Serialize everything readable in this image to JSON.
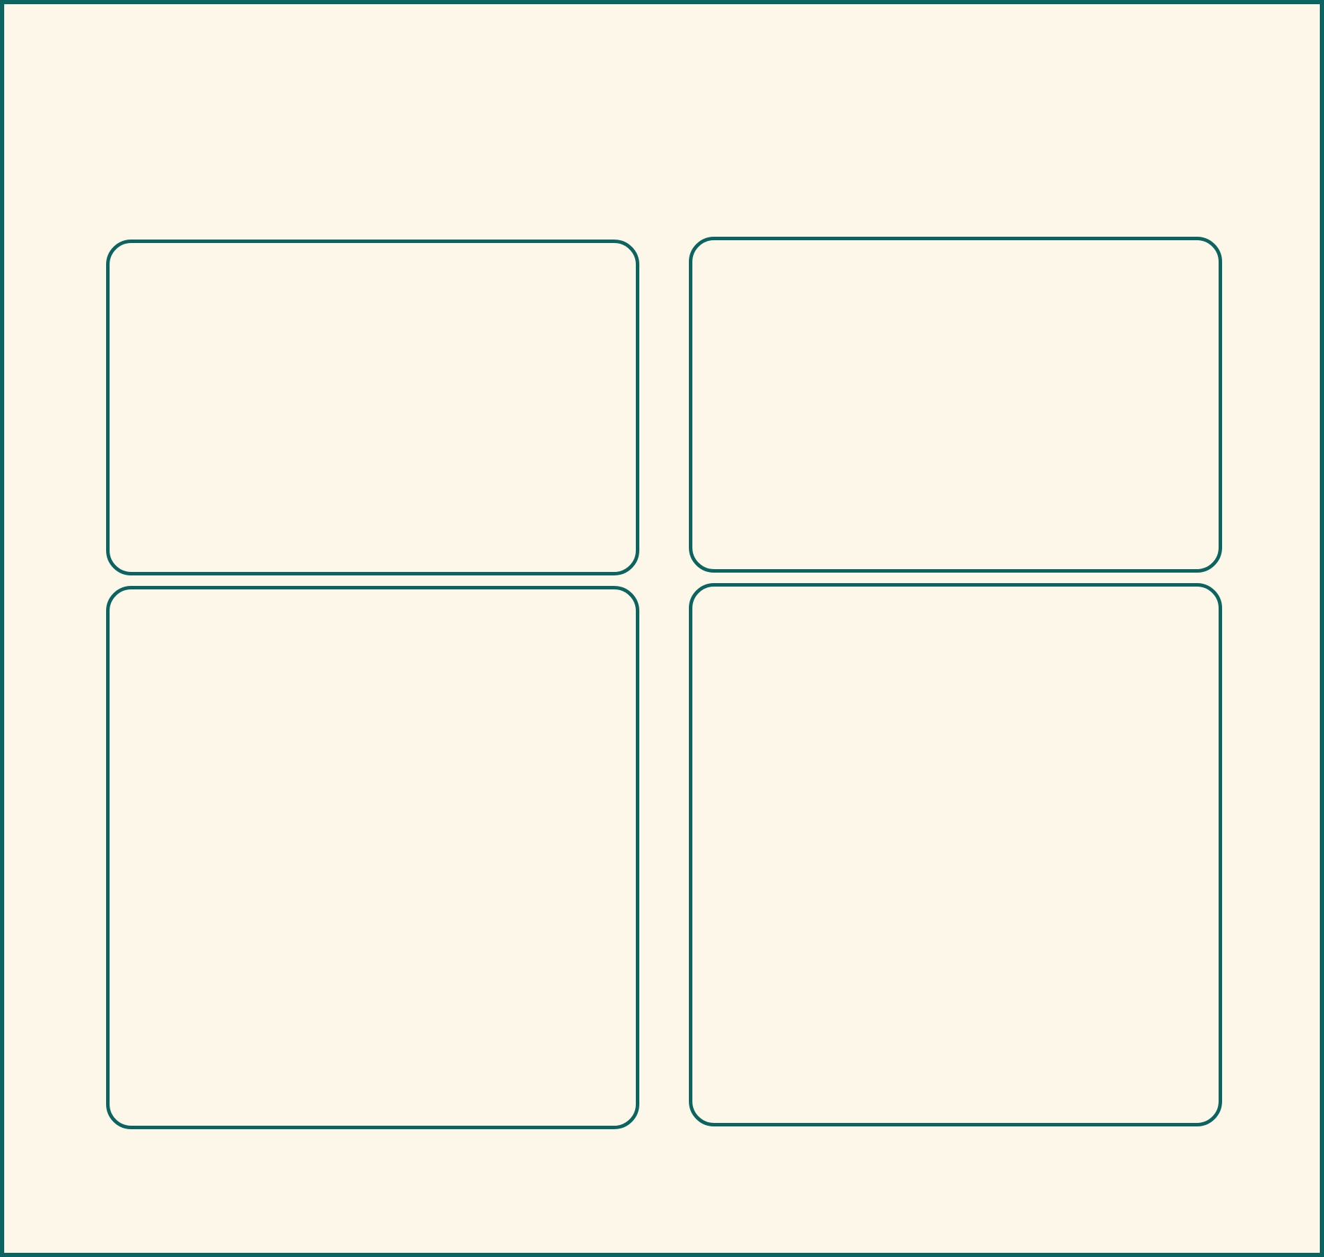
{
  "colors": {
    "background": "#fcf7e9",
    "outline": "#0b6460"
  },
  "panels": [
    {
      "id": "top-left"
    },
    {
      "id": "top-right"
    },
    {
      "id": "bottom-left"
    },
    {
      "id": "bottom-right"
    }
  ]
}
